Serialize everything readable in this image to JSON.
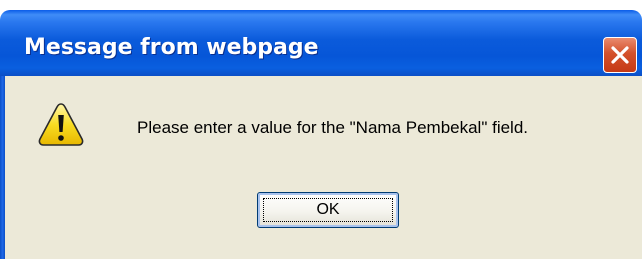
{
  "dialog": {
    "title": "Message from webpage",
    "message": "Please enter a value for the \"Nama Pembekal\" field.",
    "ok_label": "OK",
    "icon": "warning-icon",
    "close_icon": "close-icon"
  },
  "colors": {
    "titlebar": "#0b5bdb",
    "body": "#ece9d8",
    "close": "#d4512b",
    "warning": "#f5d10e"
  }
}
